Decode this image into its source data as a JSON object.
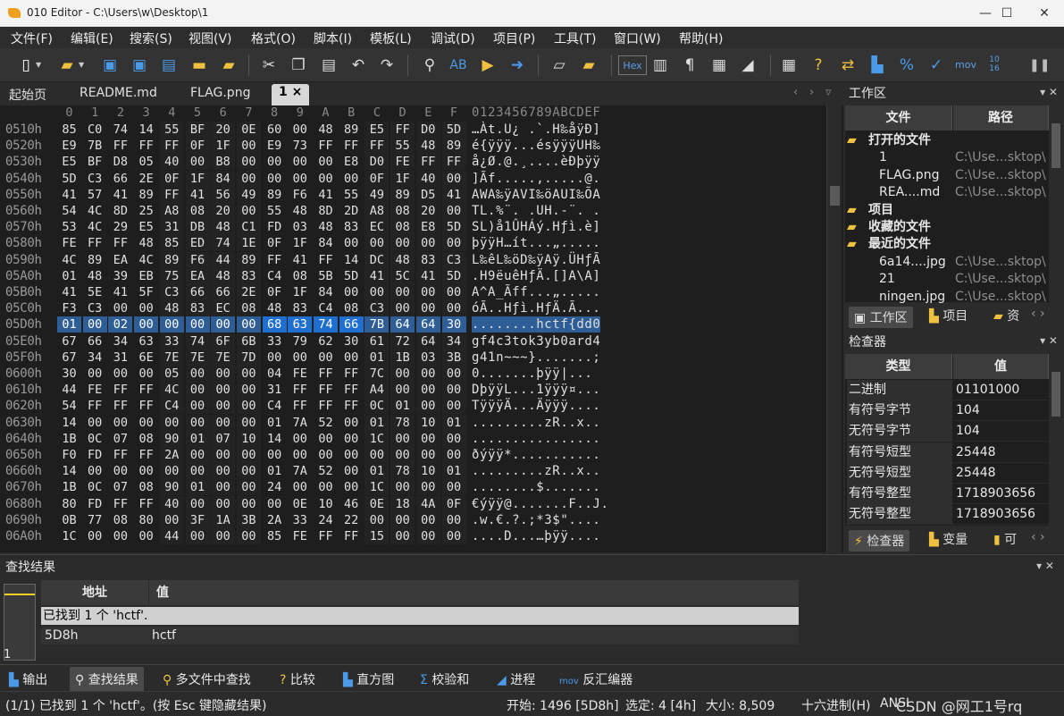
{
  "window": {
    "title": "010 Editor - C:\\Users\\w\\Desktop\\1",
    "minimize": "—",
    "maximize": "☐",
    "close": "✕"
  },
  "menu": [
    "文件(F)",
    "编辑(E)",
    "搜索(S)",
    "视图(V)",
    "格式(O)",
    "脚本(I)",
    "模板(L)",
    "调试(D)",
    "项目(P)",
    "工具(T)",
    "窗口(W)",
    "帮助(H)"
  ],
  "toolbar": {
    "hex_label": "Hex",
    "mov_label": "mov",
    "bits_label": "10\n16"
  },
  "tabs": [
    "起始页",
    "README.md",
    "FLAG.png",
    "1"
  ],
  "active_tab_close": "×",
  "hex": {
    "col_header": [
      "0",
      "1",
      "2",
      "3",
      "4",
      "5",
      "6",
      "7",
      "8",
      "9",
      "A",
      "B",
      "C",
      "D",
      "E",
      "F"
    ],
    "ascii_header": "0123456789ABCDEF",
    "rows": [
      {
        "addr": "0510h",
        "bytes": [
          "85",
          "C0",
          "74",
          "14",
          "55",
          "BF",
          "20",
          "0E",
          "60",
          "00",
          "48",
          "89",
          "E5",
          "FF",
          "D0",
          "5D"
        ],
        "ascii": "…Àt.U¿ .`.H‰åÿÐ]"
      },
      {
        "addr": "0520h",
        "bytes": [
          "E9",
          "7B",
          "FF",
          "FF",
          "FF",
          "0F",
          "1F",
          "00",
          "E9",
          "73",
          "FF",
          "FF",
          "FF",
          "55",
          "48",
          "89"
        ],
        "ascii": "é{ÿÿÿ...ésÿÿÿUH‰"
      },
      {
        "addr": "0530h",
        "bytes": [
          "E5",
          "BF",
          "D8",
          "05",
          "40",
          "00",
          "B8",
          "00",
          "00",
          "00",
          "00",
          "E8",
          "D0",
          "FE",
          "FF",
          "FF"
        ],
        "ascii": "å¿Ø.@.¸....èÐþÿÿ"
      },
      {
        "addr": "0540h",
        "bytes": [
          "5D",
          "C3",
          "66",
          "2E",
          "0F",
          "1F",
          "84",
          "00",
          "00",
          "00",
          "00",
          "00",
          "0F",
          "1F",
          "40",
          "00"
        ],
        "ascii": "]Ãf.....,.....@."
      },
      {
        "addr": "0550h",
        "bytes": [
          "41",
          "57",
          "41",
          "89",
          "FF",
          "41",
          "56",
          "49",
          "89",
          "F6",
          "41",
          "55",
          "49",
          "89",
          "D5",
          "41"
        ],
        "ascii": "AWA‰ÿAVI‰öAUI‰ÕA"
      },
      {
        "addr": "0560h",
        "bytes": [
          "54",
          "4C",
          "8D",
          "25",
          "A8",
          "08",
          "20",
          "00",
          "55",
          "48",
          "8D",
          "2D",
          "A8",
          "08",
          "20",
          "00"
        ],
        "ascii": "TL.%¨. .UH.-¨. ."
      },
      {
        "addr": "0570h",
        "bytes": [
          "53",
          "4C",
          "29",
          "E5",
          "31",
          "DB",
          "48",
          "C1",
          "FD",
          "03",
          "48",
          "83",
          "EC",
          "08",
          "E8",
          "5D"
        ],
        "ascii": "SL)å1ÛHÁý.Hƒì.è]"
      },
      {
        "addr": "0580h",
        "bytes": [
          "FE",
          "FF",
          "FF",
          "48",
          "85",
          "ED",
          "74",
          "1E",
          "0F",
          "1F",
          "84",
          "00",
          "00",
          "00",
          "00",
          "00"
        ],
        "ascii": "þÿÿH…ít...„....."
      },
      {
        "addr": "0590h",
        "bytes": [
          "4C",
          "89",
          "EA",
          "4C",
          "89",
          "F6",
          "44",
          "89",
          "FF",
          "41",
          "FF",
          "14",
          "DC",
          "48",
          "83",
          "C3"
        ],
        "ascii": "L‰êL‰öD‰ÿAÿ.ÜHƒÃ"
      },
      {
        "addr": "05A0h",
        "bytes": [
          "01",
          "48",
          "39",
          "EB",
          "75",
          "EA",
          "48",
          "83",
          "C4",
          "08",
          "5B",
          "5D",
          "41",
          "5C",
          "41",
          "5D"
        ],
        "ascii": ".H9ëuêHƒÄ.[]A\\A]"
      },
      {
        "addr": "05B0h",
        "bytes": [
          "41",
          "5E",
          "41",
          "5F",
          "C3",
          "66",
          "66",
          "2E",
          "0F",
          "1F",
          "84",
          "00",
          "00",
          "00",
          "00",
          "00"
        ],
        "ascii": "A^A_Ãff...„....."
      },
      {
        "addr": "05C0h",
        "bytes": [
          "F3",
          "C3",
          "00",
          "00",
          "48",
          "83",
          "EC",
          "08",
          "48",
          "83",
          "C4",
          "08",
          "C3",
          "00",
          "00",
          "00"
        ],
        "ascii": "óÃ..Hƒì.HƒÄ.Ã..."
      },
      {
        "addr": "05D0h",
        "bytes": [
          "01",
          "00",
          "02",
          "00",
          "00",
          "00",
          "00",
          "00",
          "68",
          "63",
          "74",
          "66",
          "7B",
          "64",
          "64",
          "30"
        ],
        "ascii": "........hctf{dd0"
      },
      {
        "addr": "05E0h",
        "bytes": [
          "67",
          "66",
          "34",
          "63",
          "33",
          "74",
          "6F",
          "6B",
          "33",
          "79",
          "62",
          "30",
          "61",
          "72",
          "64",
          "34"
        ],
        "ascii": "gf4c3tok3yb0ard4"
      },
      {
        "addr": "05F0h",
        "bytes": [
          "67",
          "34",
          "31",
          "6E",
          "7E",
          "7E",
          "7E",
          "7D",
          "00",
          "00",
          "00",
          "00",
          "01",
          "1B",
          "03",
          "3B"
        ],
        "ascii": "g41n~~~}.......;"
      },
      {
        "addr": "0600h",
        "bytes": [
          "30",
          "00",
          "00",
          "00",
          "05",
          "00",
          "00",
          "00",
          "04",
          "FE",
          "FF",
          "FF",
          "7C",
          "00",
          "00",
          "00"
        ],
        "ascii": "0.......þÿÿ|..."
      },
      {
        "addr": "0610h",
        "bytes": [
          "44",
          "FE",
          "FF",
          "FF",
          "4C",
          "00",
          "00",
          "00",
          "31",
          "FF",
          "FF",
          "FF",
          "A4",
          "00",
          "00",
          "00"
        ],
        "ascii": "DþÿÿL...1ÿÿÿ¤..."
      },
      {
        "addr": "0620h",
        "bytes": [
          "54",
          "FF",
          "FF",
          "FF",
          "C4",
          "00",
          "00",
          "00",
          "C4",
          "FF",
          "FF",
          "FF",
          "0C",
          "01",
          "00",
          "00"
        ],
        "ascii": "TÿÿÿÄ...Äÿÿÿ...."
      },
      {
        "addr": "0630h",
        "bytes": [
          "14",
          "00",
          "00",
          "00",
          "00",
          "00",
          "00",
          "00",
          "01",
          "7A",
          "52",
          "00",
          "01",
          "78",
          "10",
          "01"
        ],
        "ascii": ".........zR..x.."
      },
      {
        "addr": "0640h",
        "bytes": [
          "1B",
          "0C",
          "07",
          "08",
          "90",
          "01",
          "07",
          "10",
          "14",
          "00",
          "00",
          "00",
          "1C",
          "00",
          "00",
          "00"
        ],
        "ascii": "................"
      },
      {
        "addr": "0650h",
        "bytes": [
          "F0",
          "FD",
          "FF",
          "FF",
          "2A",
          "00",
          "00",
          "00",
          "00",
          "00",
          "00",
          "00",
          "00",
          "00",
          "00",
          "00"
        ],
        "ascii": "ðýÿÿ*..........."
      },
      {
        "addr": "0660h",
        "bytes": [
          "14",
          "00",
          "00",
          "00",
          "00",
          "00",
          "00",
          "00",
          "01",
          "7A",
          "52",
          "00",
          "01",
          "78",
          "10",
          "01"
        ],
        "ascii": ".........zR..x.."
      },
      {
        "addr": "0670h",
        "bytes": [
          "1B",
          "0C",
          "07",
          "08",
          "90",
          "01",
          "00",
          "00",
          "24",
          "00",
          "00",
          "00",
          "1C",
          "00",
          "00",
          "00"
        ],
        "ascii": "........$......."
      },
      {
        "addr": "0680h",
        "bytes": [
          "80",
          "FD",
          "FF",
          "FF",
          "40",
          "00",
          "00",
          "00",
          "00",
          "0E",
          "10",
          "46",
          "0E",
          "18",
          "4A",
          "0F"
        ],
        "ascii": "€ýÿÿ@.......F..J."
      },
      {
        "addr": "0690h",
        "bytes": [
          "0B",
          "77",
          "08",
          "80",
          "00",
          "3F",
          "1A",
          "3B",
          "2A",
          "33",
          "24",
          "22",
          "00",
          "00",
          "00",
          "00"
        ],
        "ascii": ".w.€.?.;*3$\"...."
      },
      {
        "addr": "06A0h",
        "bytes": [
          "1C",
          "00",
          "00",
          "00",
          "44",
          "00",
          "00",
          "00",
          "85",
          "FE",
          "FF",
          "FF",
          "15",
          "00",
          "00",
          "00"
        ],
        "ascii": "....D...…þÿÿ...."
      }
    ]
  },
  "workspace": {
    "title": "工作区",
    "col_file": "文件",
    "col_path": "路径",
    "rows": [
      {
        "name": "打开的文件",
        "path": "",
        "level": 0,
        "bold": true,
        "icon": "folder-open-icon"
      },
      {
        "name": "1",
        "path": "C:\\Use...sktop\\",
        "level": 1
      },
      {
        "name": "FLAG.png",
        "path": "C:\\Use...sktop\\",
        "level": 1
      },
      {
        "name": "REA....md",
        "path": "C:\\Use...sktop\\",
        "level": 1
      },
      {
        "name": "项目",
        "path": "",
        "level": 0,
        "bold": true,
        "icon": "project-folder-icon"
      },
      {
        "name": "收藏的文件",
        "path": "",
        "level": 0,
        "bold": true,
        "icon": "star-folder-icon"
      },
      {
        "name": "最近的文件",
        "path": "",
        "level": 0,
        "bold": true,
        "icon": "recent-folder-icon"
      },
      {
        "name": "6a14....jpg",
        "path": "C:\\Use...sktop\\",
        "level": 1
      },
      {
        "name": "21",
        "path": "C:\\Use...sktop\\",
        "level": 1
      },
      {
        "name": "ningen.jpg",
        "path": "C:\\Use...sktop\\",
        "level": 1
      }
    ],
    "tabs": [
      "工作区",
      "项目",
      "资"
    ]
  },
  "inspector": {
    "title": "检查器",
    "col_type": "类型",
    "col_value": "值",
    "rows": [
      {
        "k": "二进制",
        "v": "01101000"
      },
      {
        "k": "有符号字节",
        "v": "104"
      },
      {
        "k": "无符号字节",
        "v": "104"
      },
      {
        "k": "有符号短型",
        "v": "25448"
      },
      {
        "k": "无符号短型",
        "v": "25448"
      },
      {
        "k": "有符号整型",
        "v": "1718903656"
      },
      {
        "k": "无符号整型",
        "v": "1718903656"
      }
    ],
    "tabs": [
      "检查器",
      "变量",
      "可"
    ]
  },
  "results": {
    "title": "查找结果",
    "col_addr": "地址",
    "col_value": "值",
    "summary": "已找到 1 个 'hctf'.",
    "row_addr": "5D8h",
    "row_value": "hctf",
    "row_count": "1"
  },
  "bottom_tabs": [
    "输出",
    "查找结果",
    "多文件中查找",
    "比较",
    "直方图",
    "校验和",
    "进程",
    "反汇编器"
  ],
  "status": {
    "message": "(1/1) 已找到 1 个 'hctf'。(按 Esc 键隐藏结果)",
    "start": "开始: 1496 [5D8h]",
    "selected": "选定: 4 [4h]",
    "size": "大小: 8,509",
    "mode": "十六进制(H)",
    "encoding": "ANSI",
    "watermark": "CSDN @网工1号rq"
  },
  "colors": {
    "selection": "#1f6fd0",
    "highlight": "#2e5e95",
    "background": "#1e1e1e",
    "panel": "#2b2b2b"
  }
}
